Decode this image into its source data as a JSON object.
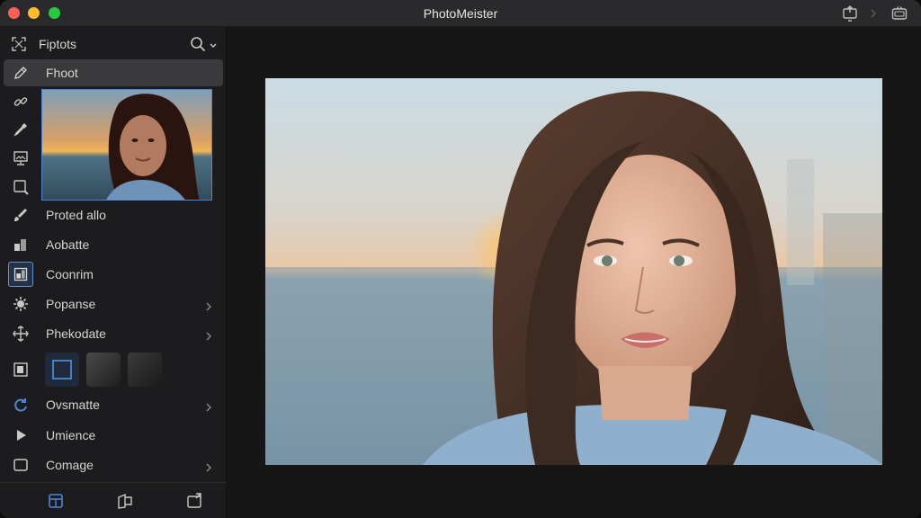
{
  "app": {
    "title": "PhotoMeister"
  },
  "titlebar_icons": [
    "share-icon",
    "chevron-right-icon",
    "tv-icon"
  ],
  "sidebar": {
    "header": {
      "label": "Fiptots",
      "icon": "crop-frame-icon"
    },
    "items": [
      {
        "id": "fhoot",
        "label": "Fhoot",
        "icon": "pencil-icon",
        "active": true
      },
      {
        "id": "link",
        "label": "",
        "icon": "link-icon"
      },
      {
        "id": "dropper",
        "label": "",
        "icon": "eyedropper-icon"
      },
      {
        "id": "image-stamp",
        "label": "",
        "icon": "image-stamp-icon"
      },
      {
        "id": "select",
        "label": "",
        "icon": "select-frame-icon"
      },
      {
        "id": "proted",
        "label": "Proted allo",
        "icon": "brush-icon"
      },
      {
        "id": "aobatte",
        "label": "Aobatte",
        "icon": "layers-icon"
      },
      {
        "id": "coonrim",
        "label": "Coonrim",
        "icon": "grid-box-icon",
        "boxed": true
      },
      {
        "id": "popanse",
        "label": "Popanse",
        "icon": "gear-icon",
        "has_arrow": true
      },
      {
        "id": "phekodate",
        "label": "Phekodate",
        "icon": "move-icon",
        "has_arrow": true
      },
      {
        "id": "ovsmatte",
        "label": "Ovsmatte",
        "icon": "refresh-icon",
        "has_arrow": true
      },
      {
        "id": "umience",
        "label": "Umience",
        "icon": "play-icon"
      },
      {
        "id": "comage",
        "label": "Comage",
        "icon": "square-icon",
        "has_arrow": true
      }
    ]
  },
  "bottom_bar": [
    "panel-icon",
    "shapes-icon",
    "export-icon"
  ],
  "colors": {
    "accent": "#4e86d6",
    "sidebar_bg": "#1c1c1e",
    "canvas_bg": "#161616"
  }
}
